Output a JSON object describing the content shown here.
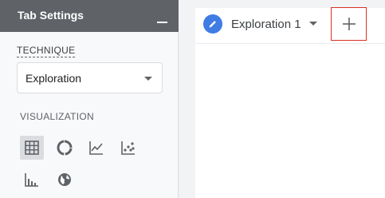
{
  "panel": {
    "title": "Tab Settings",
    "technique_label": "TECHNIQUE",
    "technique_value": "Exploration",
    "visualization_label": "VISUALIZATION",
    "visualizations": [
      {
        "icon": "table-icon",
        "selected": true
      },
      {
        "icon": "donut-chart-icon",
        "selected": false
      },
      {
        "icon": "line-chart-icon",
        "selected": false
      },
      {
        "icon": "scatter-chart-icon",
        "selected": false
      },
      {
        "icon": "bar-chart-icon",
        "selected": false
      },
      {
        "icon": "globe-icon",
        "selected": false
      }
    ]
  },
  "tabs": [
    {
      "label": "Exploration 1",
      "icon": "pencil-icon"
    }
  ],
  "add_tab": {
    "icon": "plus-icon"
  },
  "colors": {
    "header_bg": "#5f6368",
    "accent": "#3f7ce3",
    "highlight_border": "#d93025"
  }
}
